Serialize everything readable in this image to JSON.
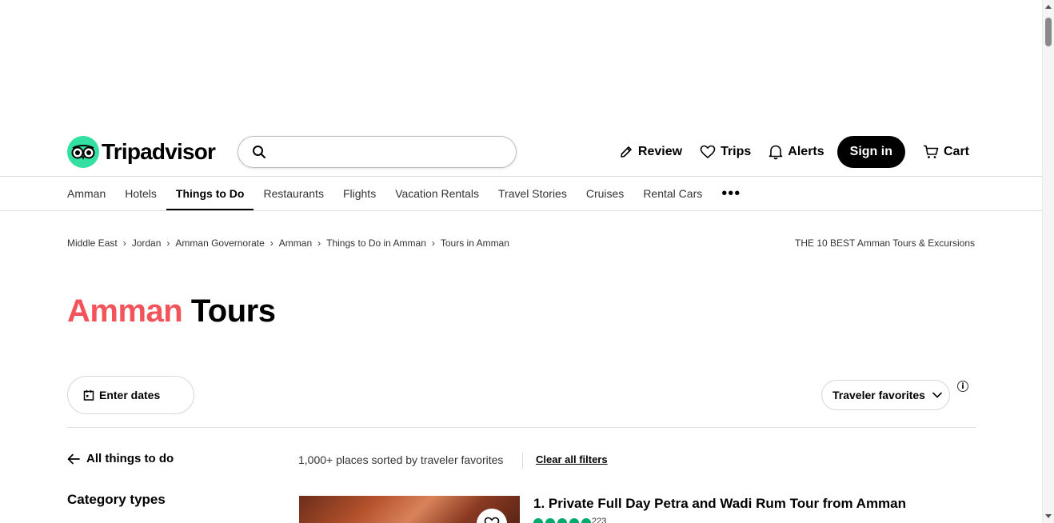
{
  "header": {
    "logo_text": "Tripadvisor",
    "search": {
      "placeholder": "",
      "value": ""
    },
    "actions": {
      "review": "Review",
      "trips": "Trips",
      "alerts": "Alerts",
      "signin": "Sign in",
      "cart": "Cart"
    }
  },
  "nav": {
    "items": [
      {
        "label": "Amman"
      },
      {
        "label": "Hotels"
      },
      {
        "label": "Things to Do",
        "active": true
      },
      {
        "label": "Restaurants"
      },
      {
        "label": "Flights"
      },
      {
        "label": "Vacation Rentals"
      },
      {
        "label": "Travel Stories"
      },
      {
        "label": "Cruises"
      },
      {
        "label": "Rental Cars"
      }
    ],
    "more_label": "•••"
  },
  "breadcrumb": {
    "items": [
      "Middle East",
      "Jordan",
      "Amman Governorate",
      "Amman",
      "Things to Do in Amman",
      "Tours in Amman"
    ],
    "separator": "›",
    "page_subtitle": "THE 10 BEST Amman Tours & Excursions"
  },
  "title": {
    "accent": "Amman",
    "rest": "Tours"
  },
  "filters": {
    "dates_label": "Enter dates",
    "sort_label": "Traveler favorites",
    "info_label": "i"
  },
  "sidebar": {
    "back_label": "All things to do",
    "category_heading": "Category types"
  },
  "results": {
    "meta": "1,000+ places sorted by traveler favorites",
    "clear_label": "Clear all filters",
    "listings": [
      {
        "title": "1. Private Full Day Petra and Wadi Rum Tour from Amman",
        "rating": 5,
        "reviews": "223"
      }
    ]
  },
  "colors": {
    "brand_green": "#34e0a1",
    "accent_red": "#f2545b",
    "rating_green": "#00aa6c"
  },
  "icons": {
    "logo": "owl-eyes-icon",
    "search": "search-icon",
    "review": "pencil-icon",
    "trips": "heart-icon",
    "alerts": "bell-icon",
    "cart": "cart-icon",
    "calendar": "calendar-icon",
    "chevron": "chevron-down-icon",
    "back": "arrow-left-icon"
  }
}
